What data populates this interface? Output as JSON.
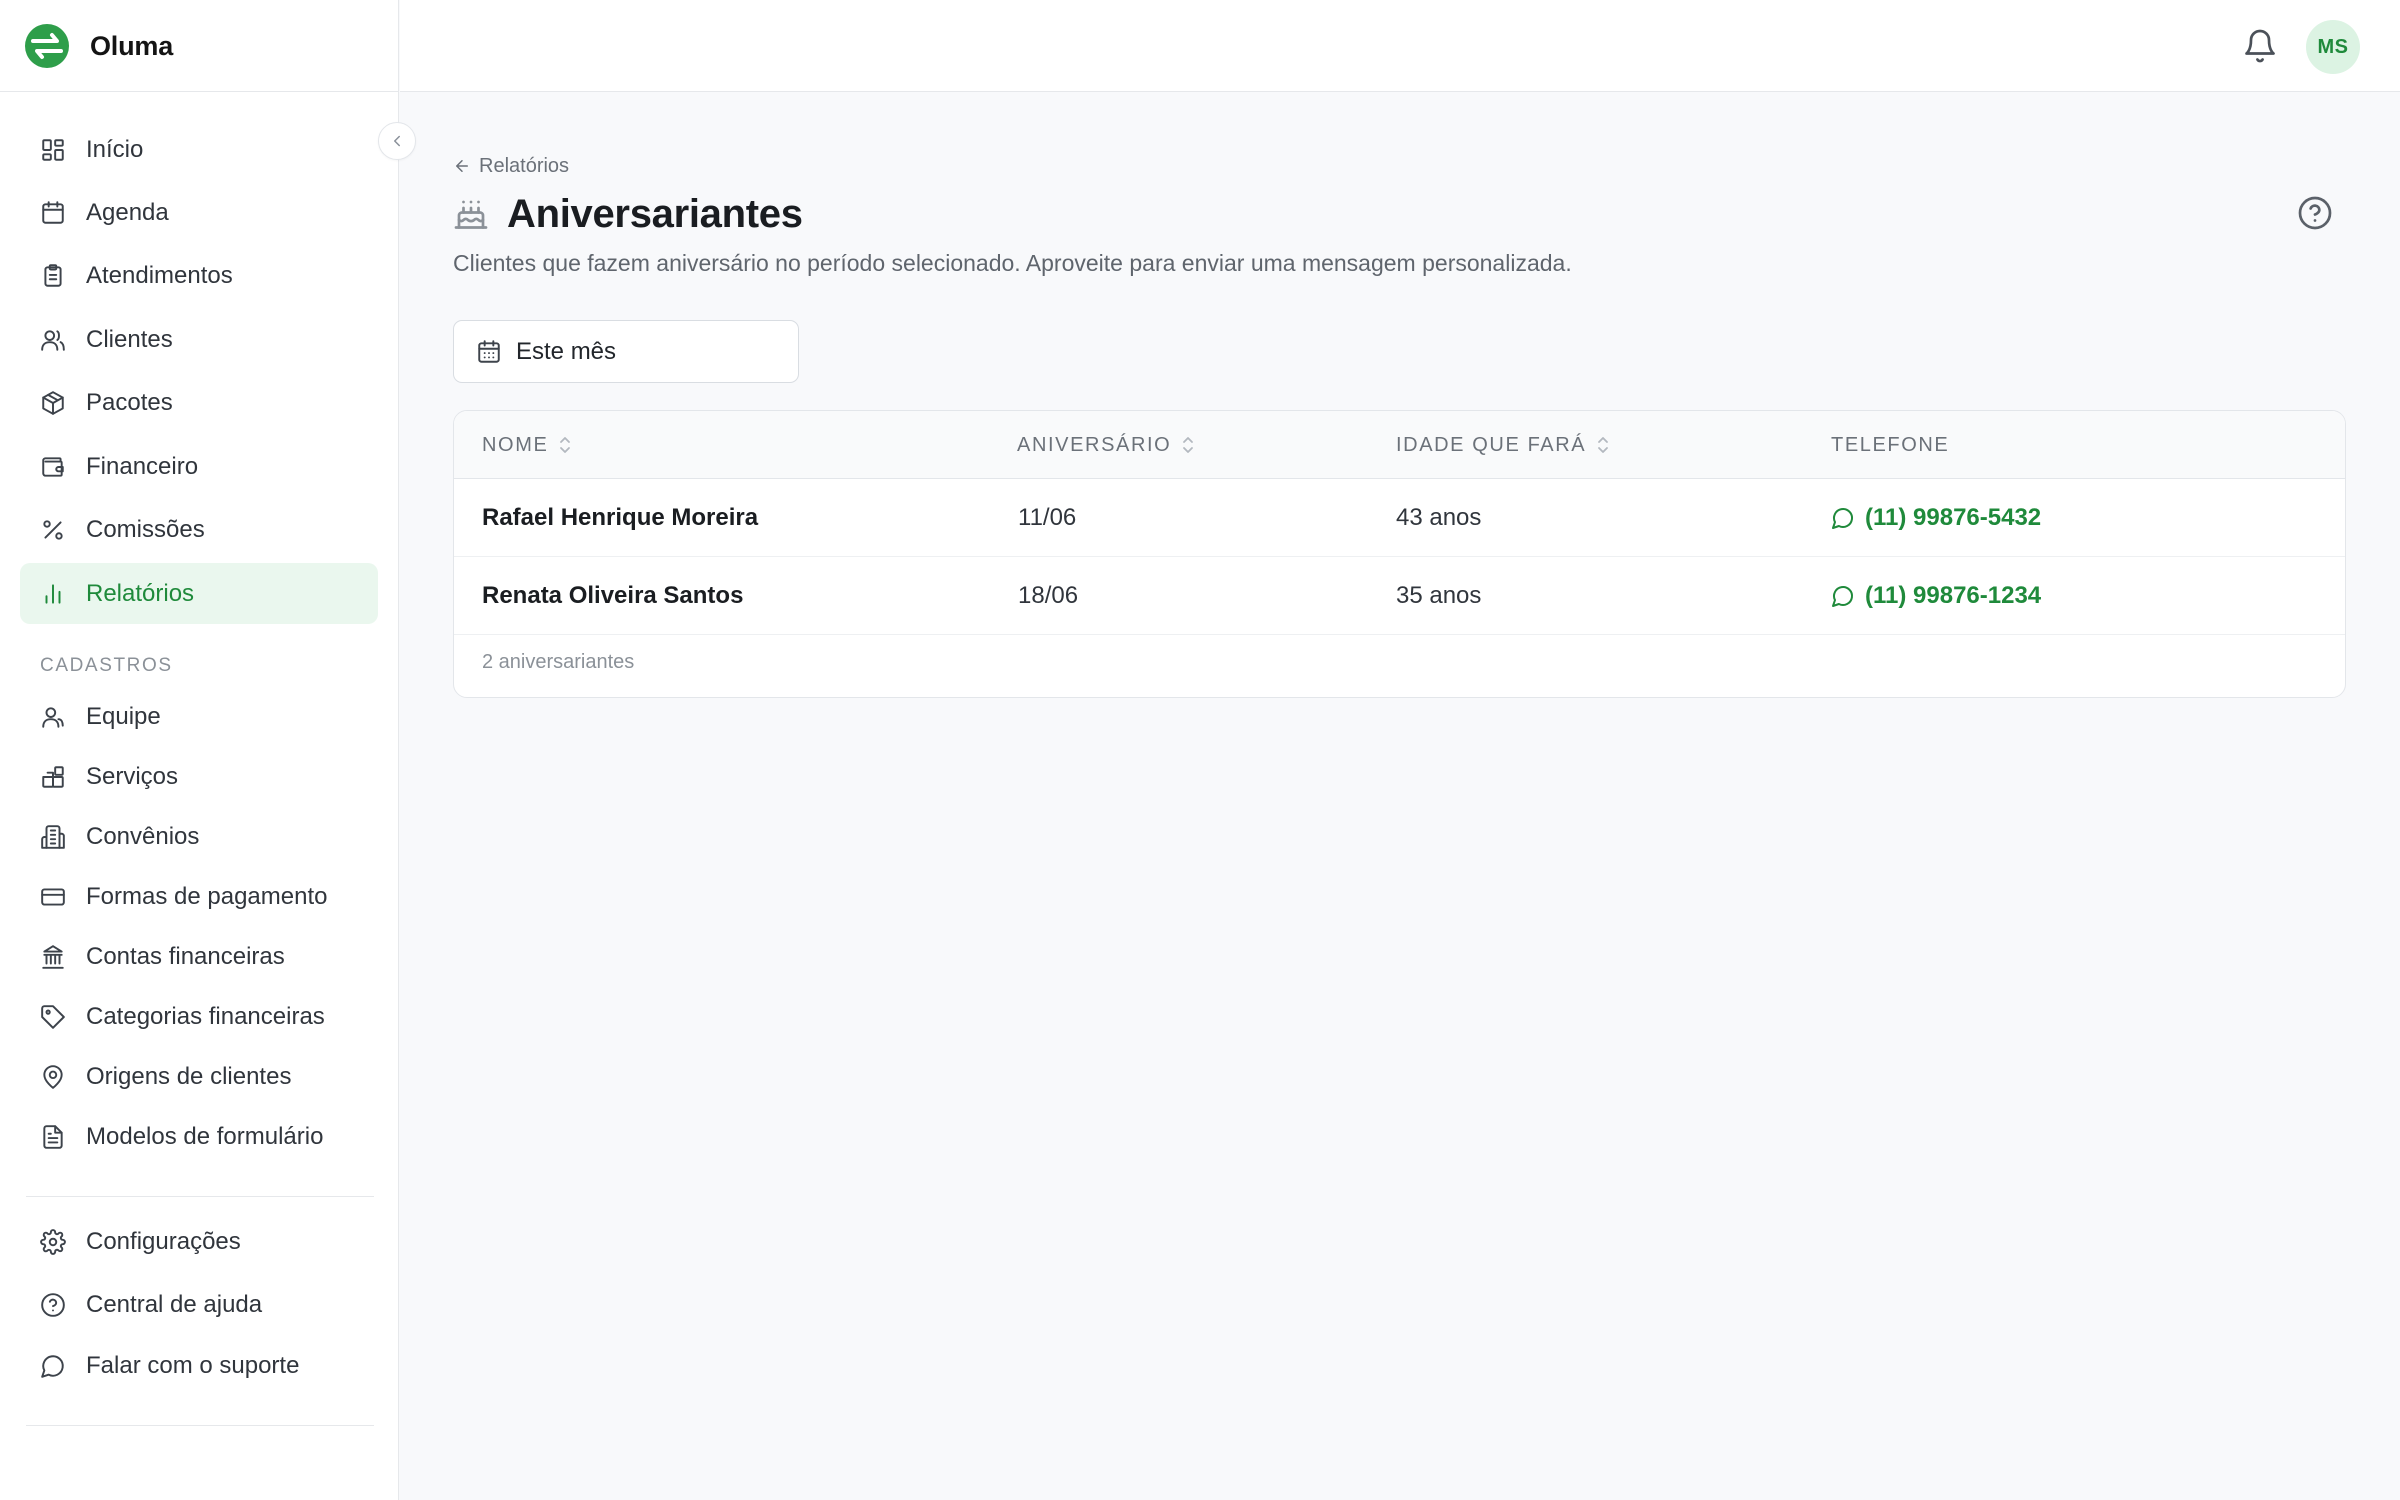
{
  "app": {
    "name": "Oluma"
  },
  "sidebar": {
    "items": [
      {
        "label": "Início",
        "icon": "dashboard-icon"
      },
      {
        "label": "Agenda",
        "icon": "calendar-icon"
      },
      {
        "label": "Atendimentos",
        "icon": "clipboard-icon"
      },
      {
        "label": "Clientes",
        "icon": "users-icon"
      },
      {
        "label": "Pacotes",
        "icon": "package-icon"
      },
      {
        "label": "Financeiro",
        "icon": "wallet-icon"
      },
      {
        "label": "Comissões",
        "icon": "percent-icon"
      },
      {
        "label": "Relatórios",
        "icon": "bar-chart-icon",
        "active": true
      }
    ],
    "section_title": "CADASTROS",
    "cadastros": [
      {
        "label": "Equipe",
        "icon": "user-group-icon"
      },
      {
        "label": "Serviços",
        "icon": "blocks-icon"
      },
      {
        "label": "Convênios",
        "icon": "building-icon"
      },
      {
        "label": "Formas de pagamento",
        "icon": "credit-card-icon"
      },
      {
        "label": "Contas financeiras",
        "icon": "bank-icon"
      },
      {
        "label": "Categorias financeiras",
        "icon": "tag-icon"
      },
      {
        "label": "Origens de clientes",
        "icon": "map-pin-icon"
      },
      {
        "label": "Modelos de formulário",
        "icon": "file-text-icon"
      }
    ],
    "footer": [
      {
        "label": "Configurações",
        "icon": "gear-icon"
      },
      {
        "label": "Central de ajuda",
        "icon": "help-circle-icon"
      },
      {
        "label": "Falar com o suporte",
        "icon": "chat-icon"
      }
    ]
  },
  "header": {
    "avatar_initials": "MS"
  },
  "page": {
    "breadcrumb": "Relatórios",
    "title": "Aniversariantes",
    "subtitle": "Clientes que fazem aniversário no período selecionado. Aproveite para enviar uma mensagem personalizada.",
    "period": "Este mês"
  },
  "table": {
    "columns": [
      "NOME",
      "ANIVERSÁRIO",
      "IDADE QUE FARÁ",
      "TELEFONE"
    ],
    "rows": [
      {
        "nome": "Rafael Henrique Moreira",
        "aniversario": "11/06",
        "idade": "43 anos",
        "telefone": "(11) 99876-5432"
      },
      {
        "nome": "Renata Oliveira Santos",
        "aniversario": "18/06",
        "idade": "35 anos",
        "telefone": "(11) 99876-1234"
      }
    ],
    "footer": "2 aniversariantes"
  },
  "colors": {
    "accent": "#1f8a3b",
    "accent_bg": "#eaf7ee",
    "logo_green": "#2e9e4a"
  }
}
